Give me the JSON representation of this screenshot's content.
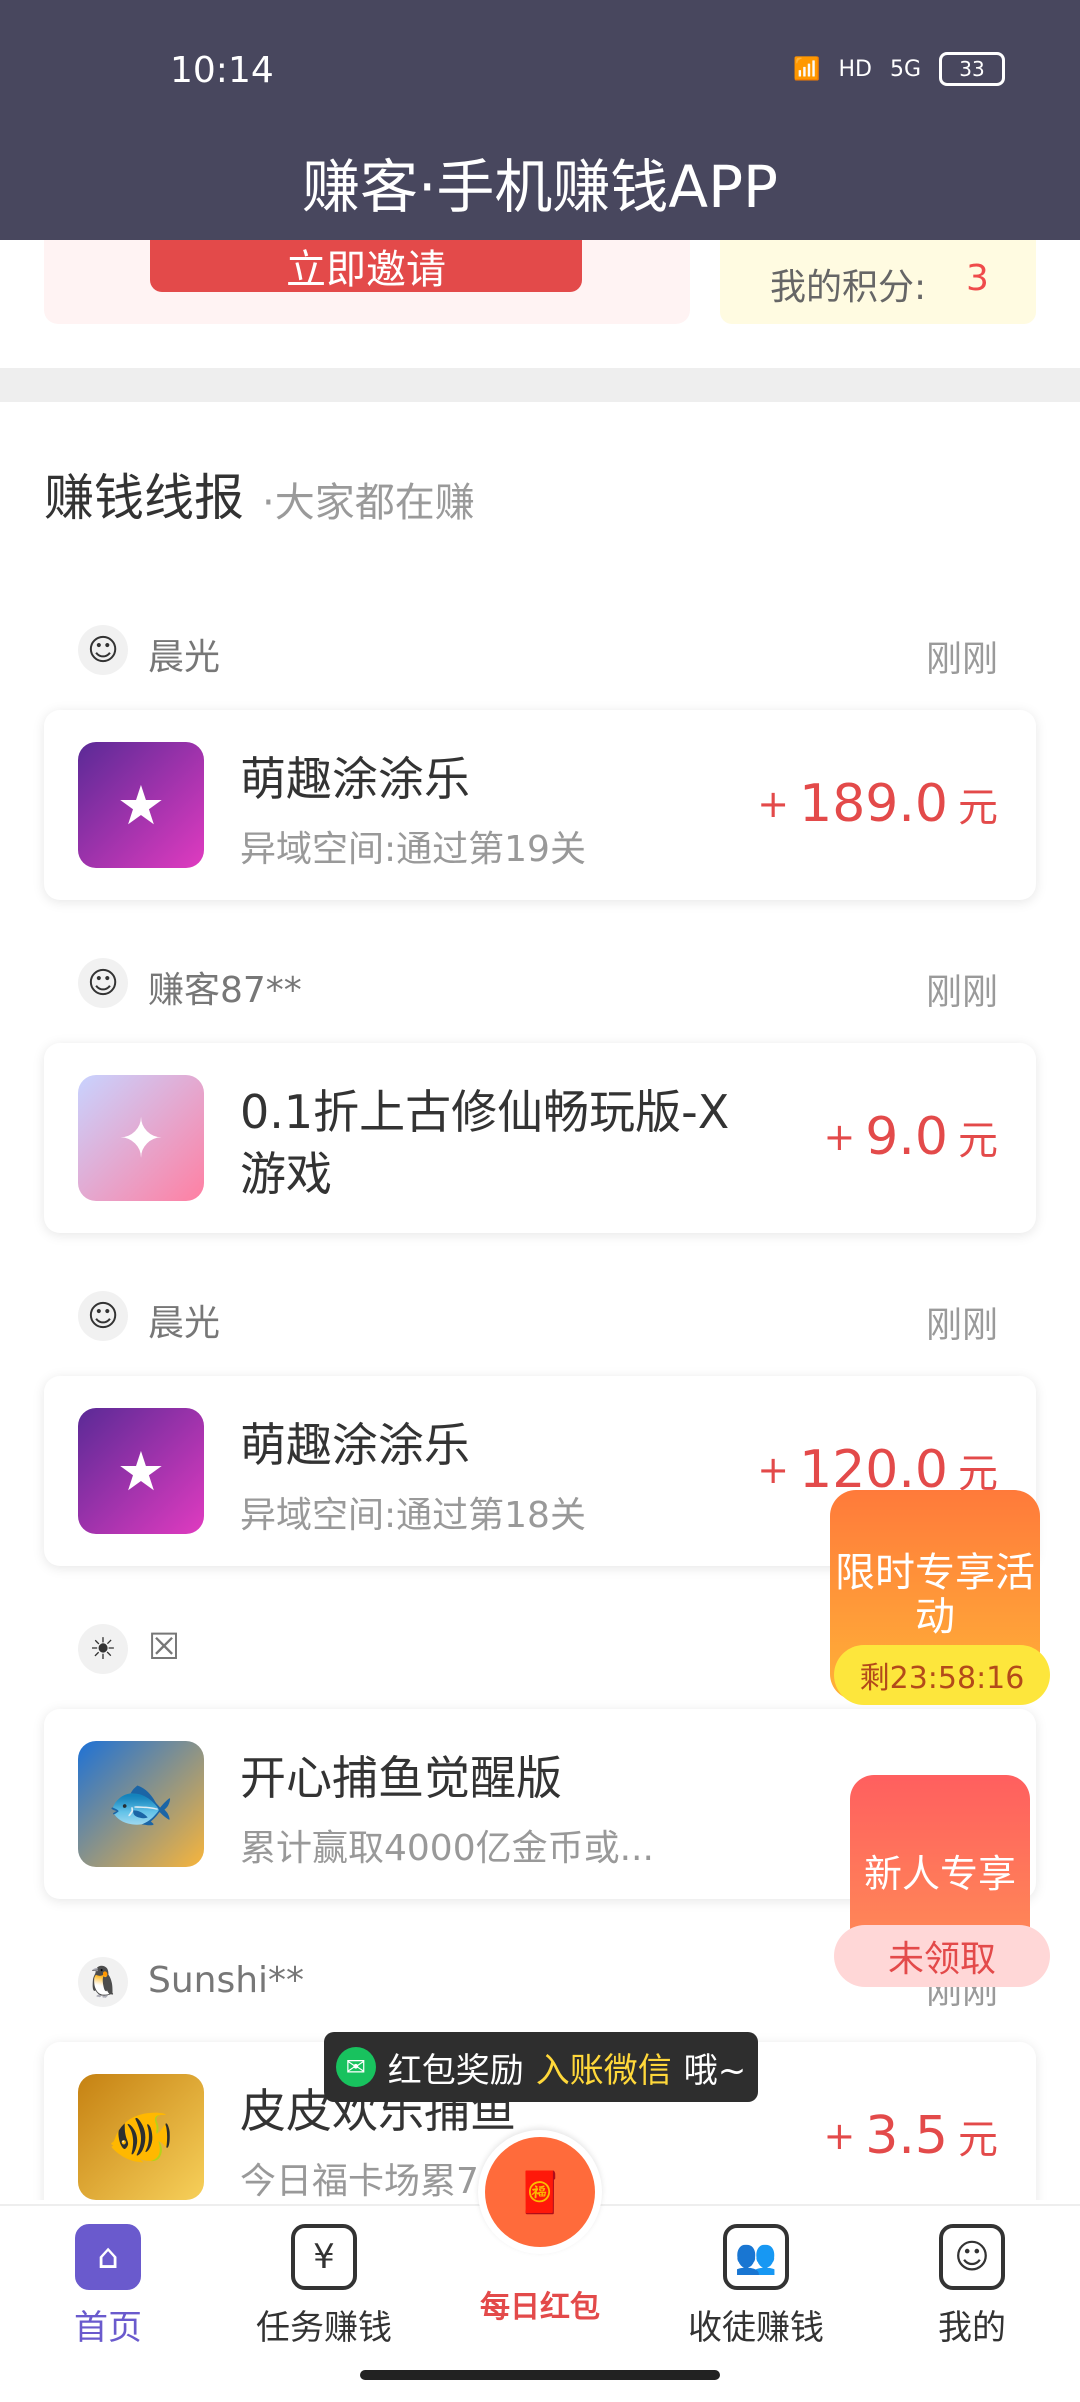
{
  "status_bar": {
    "time": "10:14",
    "battery": "33",
    "signal": "5G",
    "wifi_label": "HD"
  },
  "header": {
    "title": "赚客·手机赚钱APP"
  },
  "top_cards": {
    "invite_button": "立即邀请",
    "points_label": "我的积分:",
    "points_value": "3"
  },
  "section": {
    "title": "赚钱线报",
    "subtitle": "·大家都在赚"
  },
  "feed": [
    {
      "user": "晨光",
      "time": "刚刚",
      "game": "萌趣涂涂乐",
      "desc": "异域空间:通过第19关",
      "reward": "189.0",
      "unit": "元"
    },
    {
      "user": "赚客87**",
      "time": "刚刚",
      "game": "0.1折上古修仙畅玩版-X游戏",
      "desc": "",
      "reward": "9.0",
      "unit": "元"
    },
    {
      "user": "晨光",
      "time": "刚刚",
      "game": "萌趣涂涂乐",
      "desc": "异域空间:通过第18关",
      "reward": "120.0",
      "unit": "元"
    },
    {
      "user": "☒",
      "time": "",
      "game": "开心捕鱼觉醒版",
      "desc": "累计赢取4000亿金币或...",
      "reward": "",
      "unit": ""
    },
    {
      "user": "Sunshi**",
      "time": "刚刚",
      "game": "皮皮欢乐捕鱼",
      "desc": "今日福卡场累700...",
      "reward": "3.5",
      "unit": "元"
    }
  ],
  "promos": {
    "limited": "限时专享活动",
    "timer": "剩23:58:16",
    "newbie": "新人专享",
    "claim": "未领取"
  },
  "toast": {
    "part1": "红包奖励",
    "part2": "入账微信",
    "part3": "哦~"
  },
  "bottom_nav": {
    "home": "首页",
    "tasks": "任务赚钱",
    "daily": "每日红包",
    "recruit": "收徒赚钱",
    "mine": "我的"
  },
  "colors": {
    "header_bg": "#48475e",
    "accent_red": "#e34a4a",
    "nav_active": "#6a5acd"
  }
}
